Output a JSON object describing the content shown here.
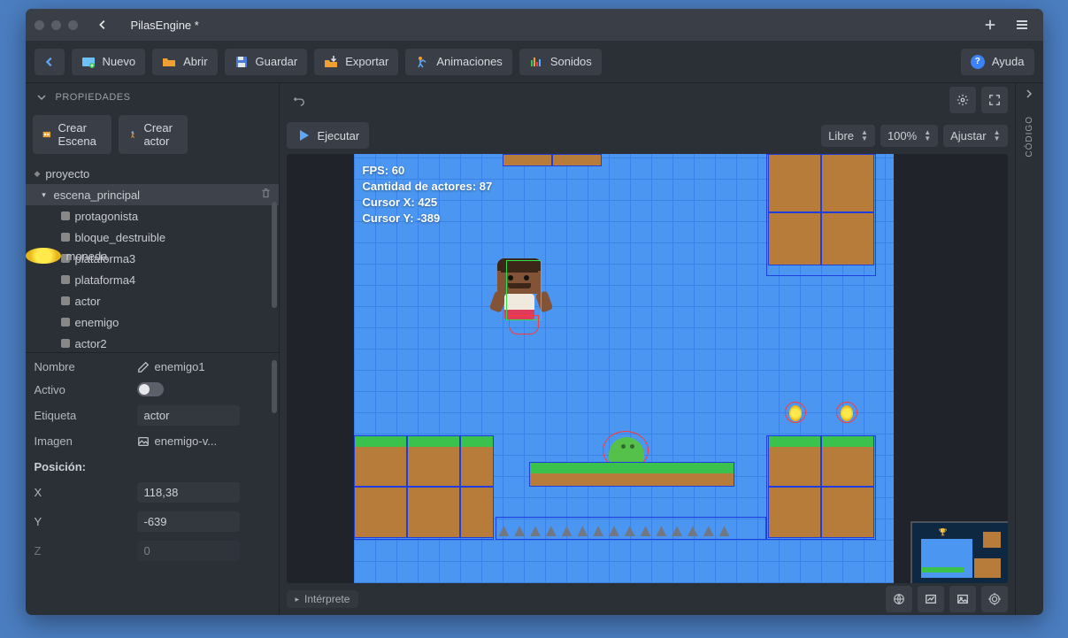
{
  "window": {
    "title": "PilasEngine *"
  },
  "toolbar": {
    "nuevo": "Nuevo",
    "abrir": "Abrir",
    "guardar": "Guardar",
    "exportar": "Exportar",
    "animaciones": "Animaciones",
    "sonidos": "Sonidos",
    "ayuda": "Ayuda"
  },
  "sidebar": {
    "heading": "PROPIEDADES",
    "crear_escena": "Crear Escena",
    "crear_actor": "Crear actor",
    "tree": {
      "root": "proyecto",
      "scene": "escena_principal",
      "items": [
        "protagonista",
        "bloque_destruible",
        "moneda",
        "plataforma3",
        "plataforma4",
        "actor",
        "enemigo",
        "actor2"
      ]
    }
  },
  "properties": {
    "labels": {
      "nombre": "Nombre",
      "activo": "Activo",
      "etiqueta": "Etiqueta",
      "imagen": "Imagen",
      "posicion": "Posición:",
      "x": "X",
      "y": "Y",
      "z": "Z"
    },
    "values": {
      "nombre": "enemigo1",
      "activo": true,
      "etiqueta": "actor",
      "imagen": "enemigo-v...",
      "x": "118,38",
      "y": "-639",
      "z": "0"
    }
  },
  "canvas": {
    "ejecutar": "Ejecutar",
    "mode": "Libre",
    "zoom": "100%",
    "fit": "Ajustar",
    "overlay": {
      "fps_label": "FPS:",
      "fps": "60",
      "actors_label": "Cantidad de actores:",
      "actors": "87",
      "cx_label": "Cursor X:",
      "cx": "425",
      "cy_label": "Cursor Y:",
      "cy": "-389"
    },
    "interprete": "Intérprete"
  },
  "rail": {
    "codigo": "CÓDIGO"
  }
}
